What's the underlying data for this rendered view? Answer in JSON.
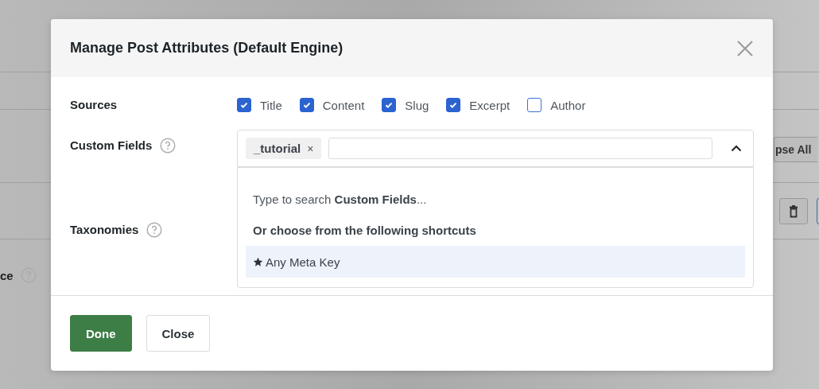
{
  "background": {
    "toolbar_button": "pse All",
    "field_label": "ce"
  },
  "dialog": {
    "title": "Manage Post Attributes (Default Engine)",
    "sources": {
      "label": "Sources",
      "options": [
        {
          "label": "Title",
          "checked": true
        },
        {
          "label": "Content",
          "checked": true
        },
        {
          "label": "Slug",
          "checked": true
        },
        {
          "label": "Excerpt",
          "checked": true
        },
        {
          "label": "Author",
          "checked": false
        }
      ]
    },
    "custom_fields": {
      "label": "Custom Fields",
      "tags": [
        {
          "label": "_tutorial",
          "remove": "×"
        }
      ],
      "dropdown": {
        "expanded": true,
        "hint": "Type to search **Custom Fields**...",
        "heading": "Or choose from the following shortcuts",
        "options": [
          {
            "label": "Any Meta Key",
            "highlighted": true
          }
        ]
      }
    },
    "taxonomies": {
      "label": "Taxonomies"
    },
    "buttons": [
      {
        "label": "Done",
        "kind": "primary"
      },
      {
        "label": "Close",
        "kind": "secondary"
      }
    ]
  }
}
